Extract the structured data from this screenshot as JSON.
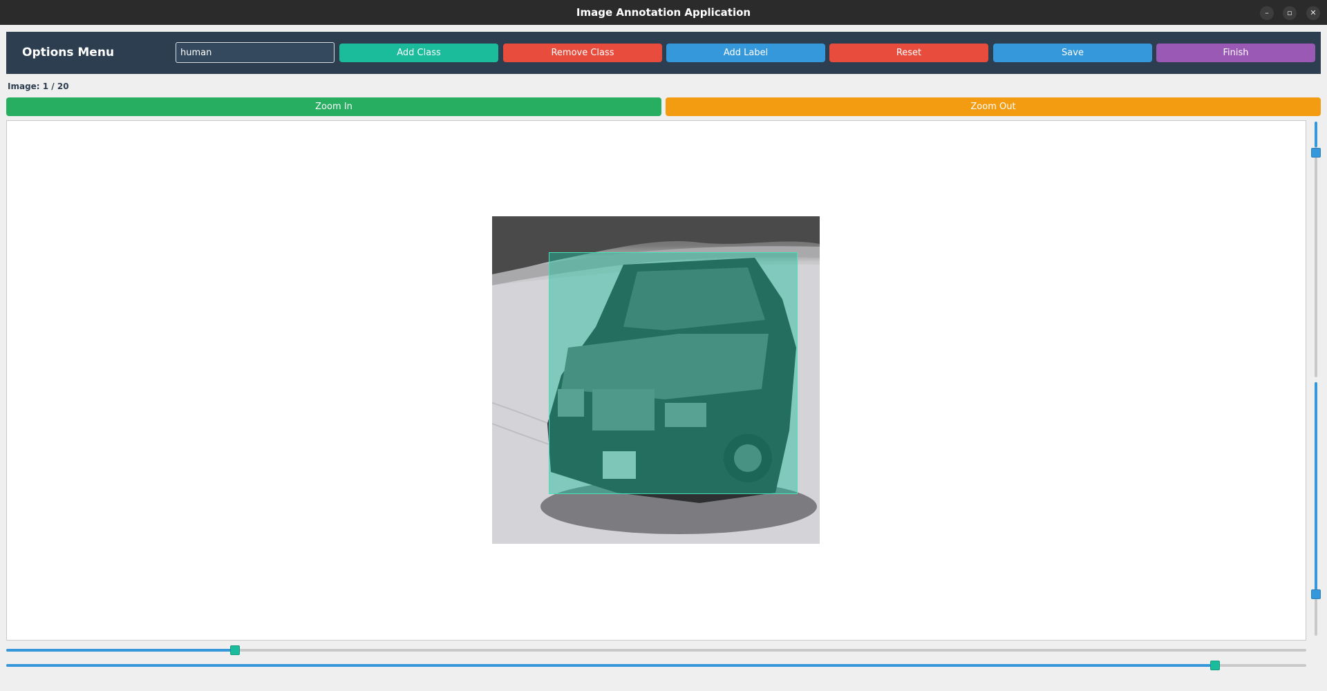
{
  "window": {
    "title": "Image Annotation Application",
    "minimize_icon": "minimize-icon",
    "maximize_icon": "maximize-icon",
    "close_icon": "close-icon"
  },
  "options": {
    "heading": "Options Menu",
    "class_input_value": "human",
    "add_class": "Add Class",
    "remove_class": "Remove Class",
    "add_label": "Add Label",
    "reset": "Reset",
    "save": "Save",
    "finish": "Finish"
  },
  "image_counter": "Image: 1 / 20",
  "zoom": {
    "zoom_in": "Zoom In",
    "zoom_out": "Zoom Out"
  },
  "annotation": {
    "bbox_color": "#1abc9c"
  },
  "sliders": {
    "vertical_top_level": 0.1,
    "vertical_bottom_level": 0.82,
    "horizontal_top_level": 0.175,
    "horizontal_bottom_level": 0.93
  },
  "colors": {
    "options_bar": "#2c3e50",
    "add_class": "#1abc9c",
    "remove_class": "#e74c3c",
    "add_label": "#3498db",
    "reset": "#e74c3c",
    "save": "#3498db",
    "finish": "#9b59b6",
    "zoom_in": "#27ae60",
    "zoom_out": "#f39c12"
  }
}
